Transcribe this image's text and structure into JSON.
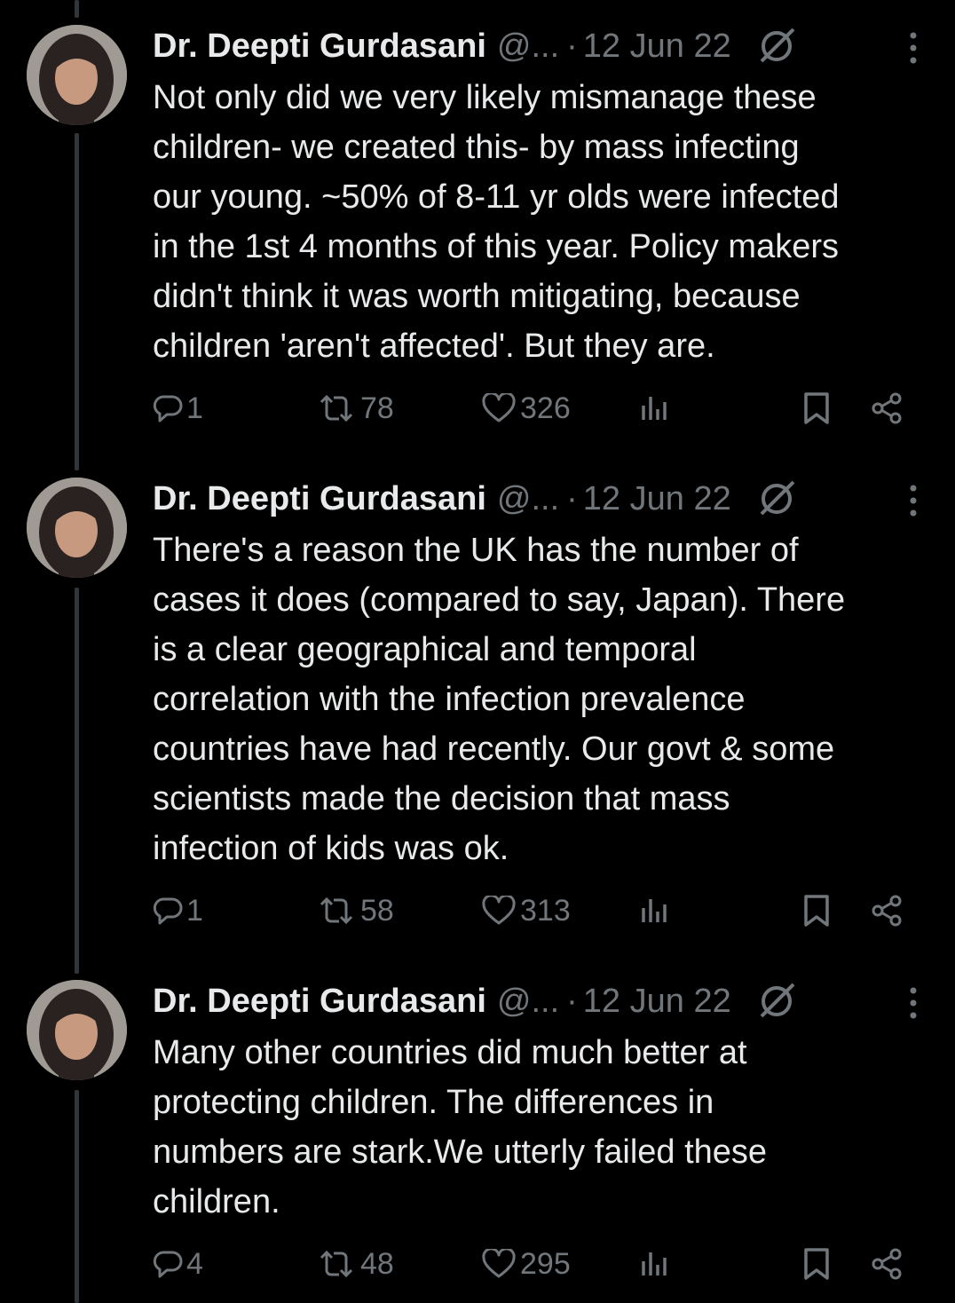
{
  "tweets": [
    {
      "author": "Dr. Deepti Gurdasani",
      "handle": "@...",
      "separator": "·",
      "date": "12 Jun 22",
      "text": "Not only did we very likely mismanage these\nchildren- we created this- by mass infecting\nour young. ~50% of 8-11 yr olds were infected\nin the 1st 4 months of this year. Policy makers\ndidn't think it was worth mitigating, because\nchildren 'aren't affected'. But they are.",
      "replies": "1",
      "reposts": "78",
      "likes": "326"
    },
    {
      "author": "Dr. Deepti Gurdasani",
      "handle": "@...",
      "separator": "·",
      "date": "12 Jun 22",
      "text": "There's a reason the UK has the number of\ncases it does (compared to say, Japan). There\nis a clear geographical and temporal\ncorrelation with the infection prevalence\ncountries have had recently. Our govt & some\nscientists made the decision that mass\ninfection of kids was ok.",
      "replies": "1",
      "reposts": "58",
      "likes": "313"
    },
    {
      "author": "Dr. Deepti Gurdasani",
      "handle": "@...",
      "separator": "·",
      "date": "12 Jun 22",
      "text": "Many other countries did much better at\nprotecting children. The differences in\nnumbers are stark.We utterly failed these\nchildren.",
      "replies": "4",
      "reposts": "48",
      "likes": "295"
    }
  ],
  "icons": [
    "reply-icon",
    "repost-icon",
    "like-icon",
    "views-icon",
    "bookmark-icon",
    "share-icon",
    "grok-icon",
    "more-icon"
  ],
  "colors": {
    "background": "#000000",
    "text": "#e7e9ea",
    "secondary": "#71767b",
    "thread_line": "#333639"
  }
}
